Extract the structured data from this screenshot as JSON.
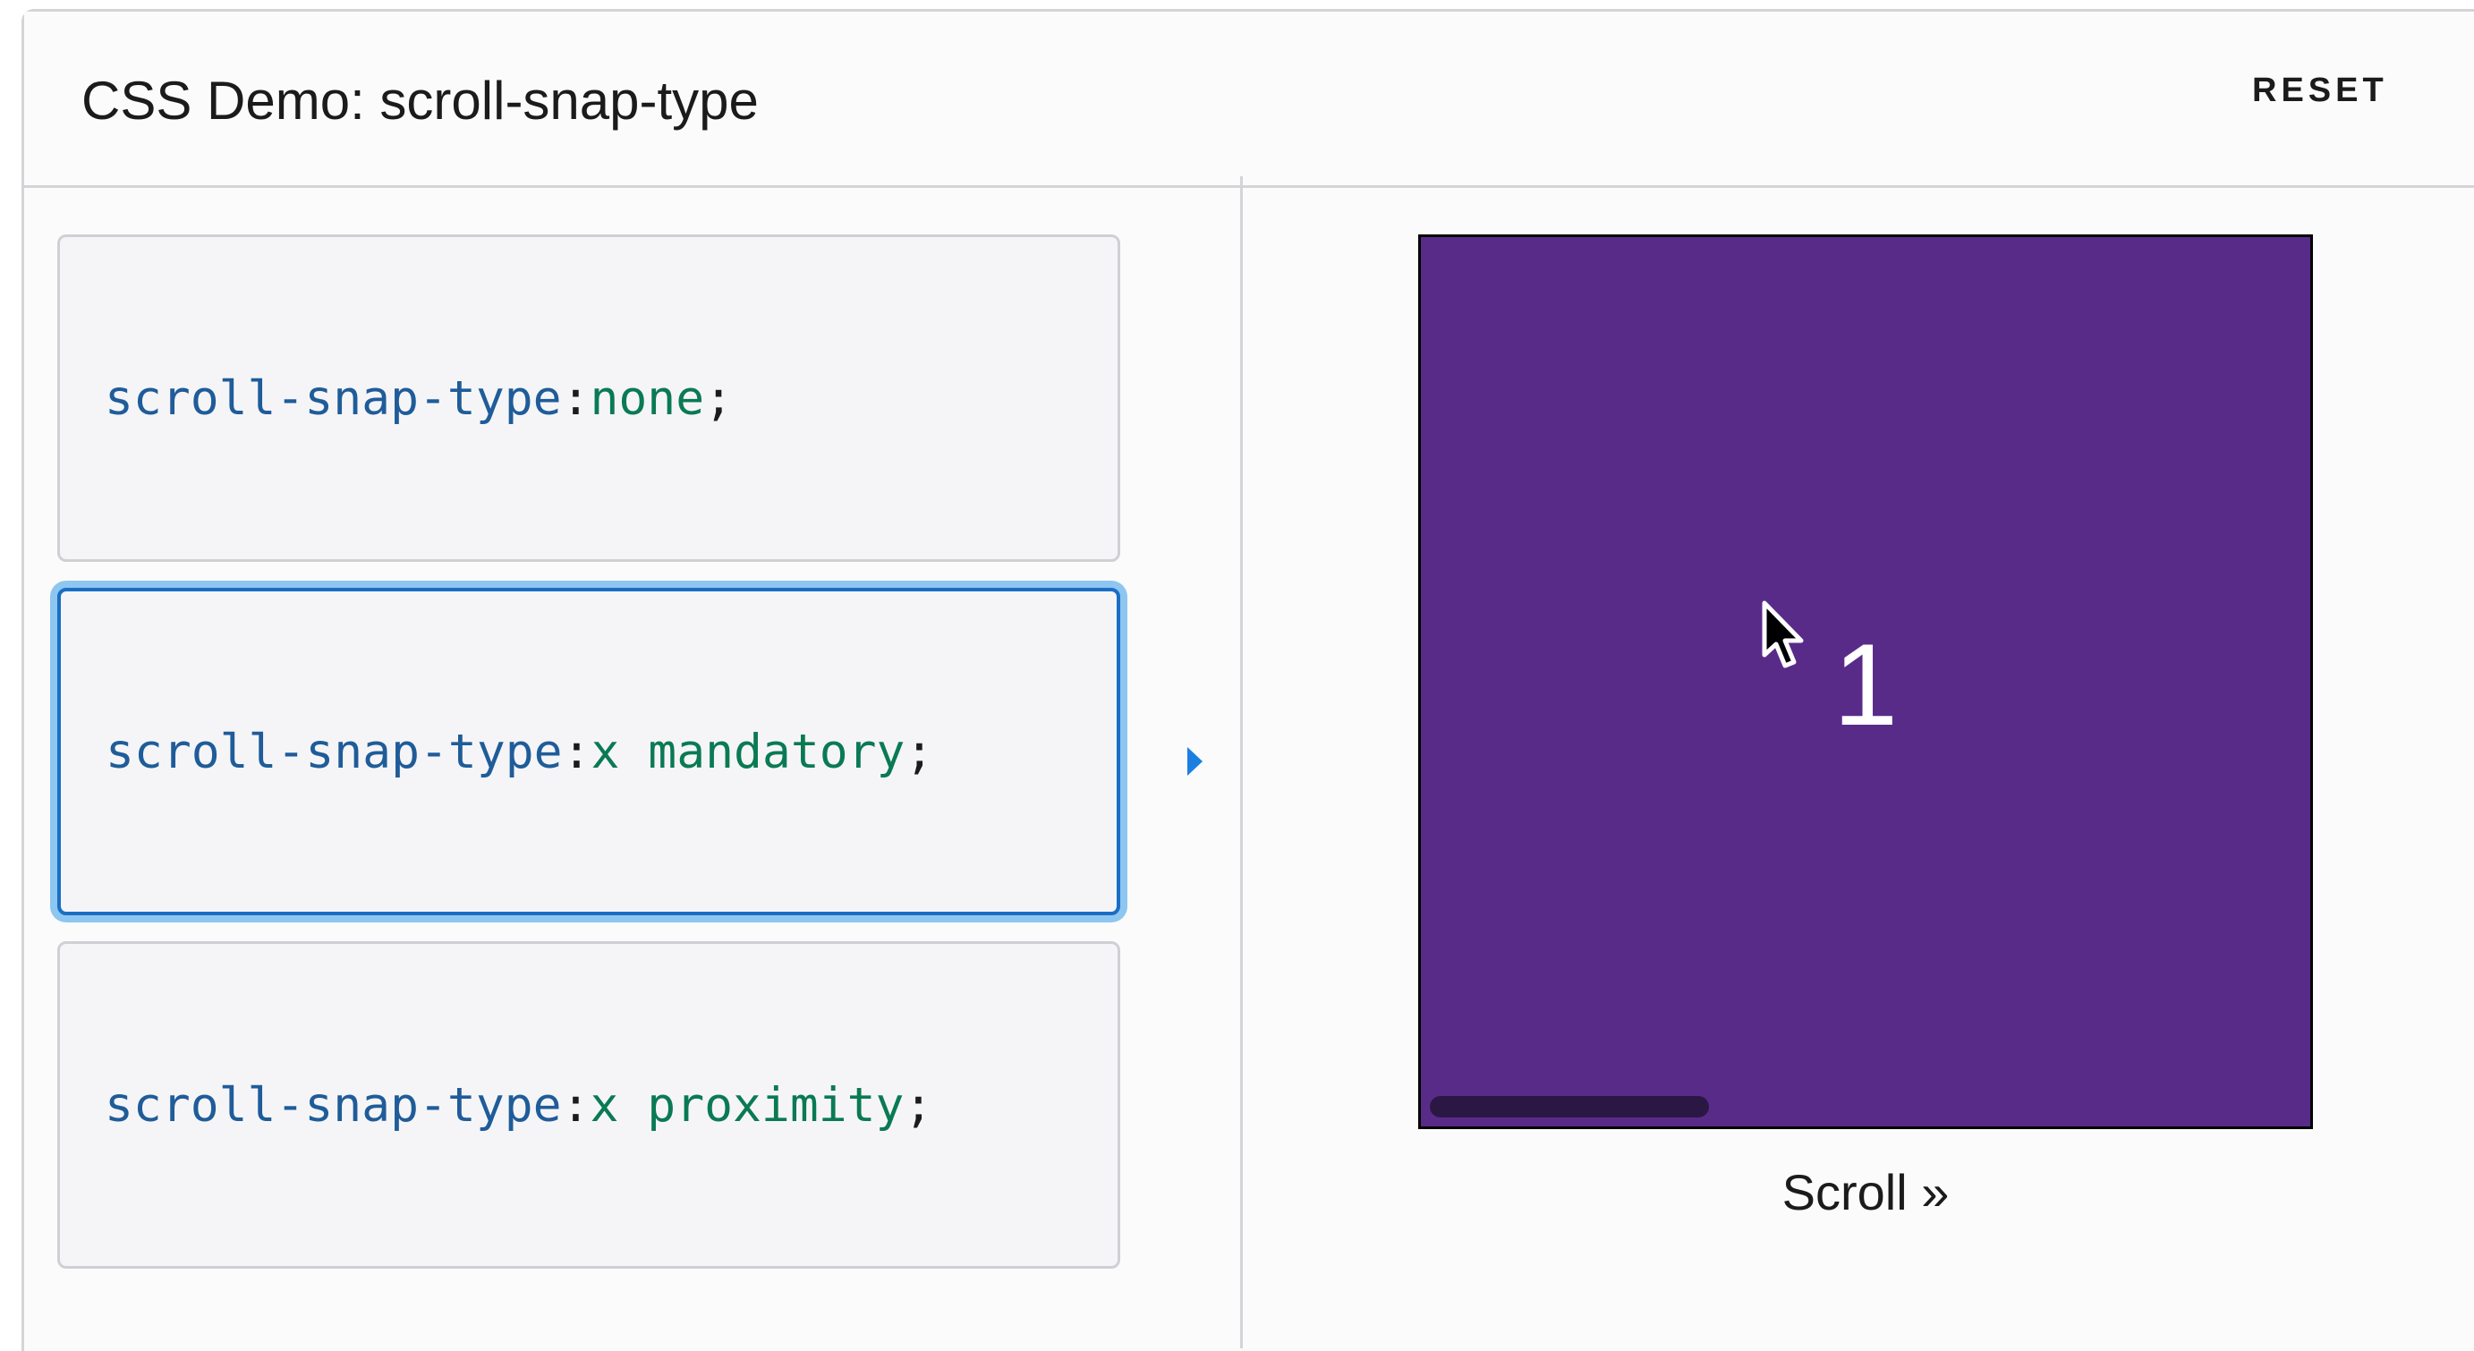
{
  "header": {
    "title": "CSS Demo: scroll-snap-type",
    "reset_label": "RESET"
  },
  "choices": [
    {
      "property": "scroll-snap-type",
      "colon": ": ",
      "value": "none",
      "semicolon": ";",
      "selected": false
    },
    {
      "property": "scroll-snap-type",
      "colon": ": ",
      "value": "x mandatory",
      "semicolon": ";",
      "selected": true
    },
    {
      "property": "scroll-snap-type",
      "colon": ": ",
      "value": "x proximity",
      "semicolon": ";",
      "selected": false
    }
  ],
  "output": {
    "slide_number": "1",
    "scroll_label": "Scroll »",
    "scroll_progress": 0.0
  },
  "colors": {
    "accent": "#1a6ec4",
    "selection_glow": "#8dc6f0",
    "scroller_bg": "#592b89",
    "property_text": "#1f5c99",
    "value_text": "#0a7a53",
    "arrow": "#1a7fe0"
  },
  "icons": {
    "selected_indicator": "triangle-right-icon",
    "pointer": "mouse-cursor-icon"
  }
}
